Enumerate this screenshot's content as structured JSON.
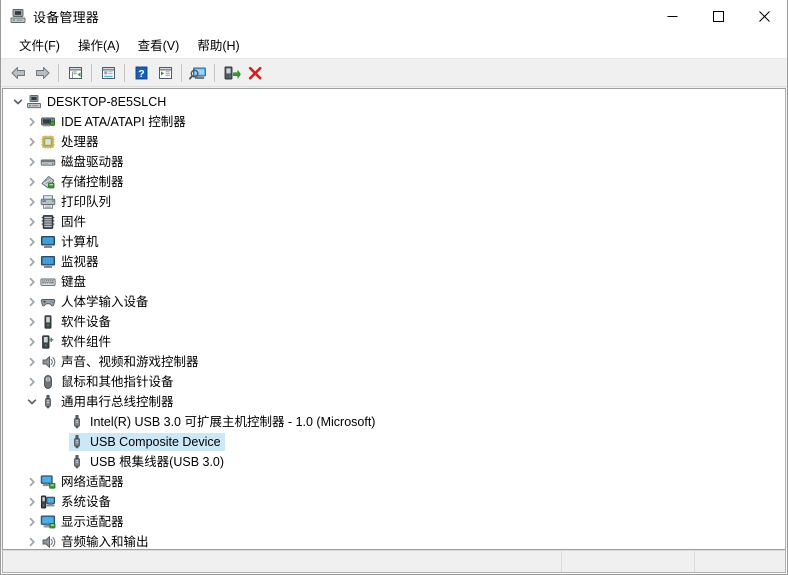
{
  "window": {
    "title": "设备管理器",
    "title_icon": "device-manager-icon",
    "controls": {
      "minimize": "—",
      "maximize": "▢",
      "close": "✕",
      "minimize_name": "minimize-button",
      "maximize_name": "maximize-button",
      "close_name": "close-button"
    }
  },
  "menubar": {
    "items": [
      {
        "label": "文件(F)",
        "name": "menu-file"
      },
      {
        "label": "操作(A)",
        "name": "menu-action"
      },
      {
        "label": "查看(V)",
        "name": "menu-view"
      },
      {
        "label": "帮助(H)",
        "name": "menu-help"
      }
    ]
  },
  "toolbar": {
    "buttons": [
      {
        "name": "back-arrow-icon",
        "title": "后退"
      },
      {
        "name": "forward-arrow-icon",
        "title": "前进"
      },
      {
        "name": "show-hide-console-tree-icon",
        "title": "显示/隐藏控制台树"
      },
      {
        "name": "properties-icon",
        "title": "属性"
      },
      {
        "name": "help-icon",
        "title": "帮助"
      },
      {
        "name": "scan-list-icon",
        "title": "列表"
      },
      {
        "name": "scan-hardware-changes-icon",
        "title": "扫描检测硬件改动"
      },
      {
        "name": "update-driver-icon",
        "title": "更新驱动程序"
      },
      {
        "name": "uninstall-device-icon",
        "title": "卸载设备"
      }
    ]
  },
  "tree": {
    "root": {
      "label": "DESKTOP-8E5SLCH",
      "icon": "computer-icon",
      "expanded": true,
      "level": 0
    },
    "nodes": [
      {
        "label": "IDE ATA/ATAPI 控制器",
        "icon": "ide-controller-icon",
        "level": 1,
        "expanded": false,
        "selected": false
      },
      {
        "label": "处理器",
        "icon": "processor-icon",
        "level": 1,
        "expanded": false,
        "selected": false
      },
      {
        "label": "磁盘驱动器",
        "icon": "disk-drive-icon",
        "level": 1,
        "expanded": false,
        "selected": false
      },
      {
        "label": "存储控制器",
        "icon": "storage-controller-icon",
        "level": 1,
        "expanded": false,
        "selected": false
      },
      {
        "label": "打印队列",
        "icon": "print-queue-icon",
        "level": 1,
        "expanded": false,
        "selected": false
      },
      {
        "label": "固件",
        "icon": "firmware-icon",
        "level": 1,
        "expanded": false,
        "selected": false
      },
      {
        "label": "计算机",
        "icon": "monitor-icon",
        "level": 1,
        "expanded": false,
        "selected": false
      },
      {
        "label": "监视器",
        "icon": "monitor-icon",
        "level": 1,
        "expanded": false,
        "selected": false
      },
      {
        "label": "键盘",
        "icon": "keyboard-icon",
        "level": 1,
        "expanded": false,
        "selected": false
      },
      {
        "label": "人体学输入设备",
        "icon": "hid-icon",
        "level": 1,
        "expanded": false,
        "selected": false
      },
      {
        "label": "软件设备",
        "icon": "software-device-icon",
        "level": 1,
        "expanded": false,
        "selected": false
      },
      {
        "label": "软件组件",
        "icon": "software-component-icon",
        "level": 1,
        "expanded": false,
        "selected": false
      },
      {
        "label": "声音、视频和游戏控制器",
        "icon": "speaker-icon",
        "level": 1,
        "expanded": false,
        "selected": false
      },
      {
        "label": "鼠标和其他指针设备",
        "icon": "mouse-icon",
        "level": 1,
        "expanded": false,
        "selected": false
      },
      {
        "label": "通用串行总线控制器",
        "icon": "usb-icon",
        "level": 1,
        "expanded": true,
        "selected": false
      },
      {
        "label": "Intel(R) USB 3.0 可扩展主机控制器 - 1.0 (Microsoft)",
        "icon": "usb-icon",
        "level": 2,
        "expanded": null,
        "selected": false
      },
      {
        "label": "USB Composite Device",
        "icon": "usb-icon",
        "level": 2,
        "expanded": null,
        "selected": true
      },
      {
        "label": "USB 根集线器(USB 3.0)",
        "icon": "usb-icon",
        "level": 2,
        "expanded": null,
        "selected": false
      },
      {
        "label": "网络适配器",
        "icon": "network-adapter-icon",
        "level": 1,
        "expanded": false,
        "selected": false
      },
      {
        "label": "系统设备",
        "icon": "system-device-icon",
        "level": 1,
        "expanded": false,
        "selected": false
      },
      {
        "label": "显示适配器",
        "icon": "display-adapter-icon",
        "level": 1,
        "expanded": false,
        "selected": false
      },
      {
        "label": "音频输入和输出",
        "icon": "audio-io-icon",
        "level": 1,
        "expanded": false,
        "selected": false
      }
    ]
  },
  "statusbar": {
    "panel1": "",
    "panel2": "",
    "panel3": ""
  },
  "colors": {
    "selection": "#cce8f7",
    "toolbar_bg": "#f0f0f0",
    "uninstall_red": "#d61f1f",
    "help_blue": "#1b5fb5",
    "accent_green": "#3a9b35"
  }
}
